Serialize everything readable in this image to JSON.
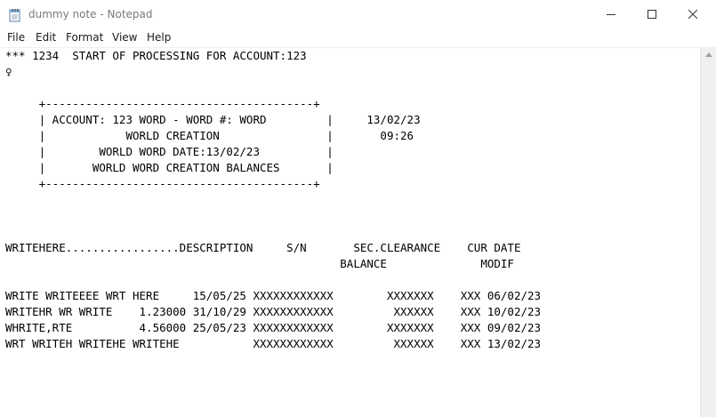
{
  "window": {
    "title": "dummy note - Notepad",
    "minimize_glyph": "—",
    "maximize_glyph": "☐",
    "close_glyph": "✕"
  },
  "menu": [
    "File",
    "Edit",
    "Format",
    "View",
    "Help"
  ],
  "editor": {
    "lines": [
      "*** 1234  START OF PROCESSING FOR ACCOUNT:123",
      "♀",
      "",
      "     +----------------------------------------+",
      "     | ACCOUNT: 123 WORD - WORD #: WORD         |     13/02/23",
      "     |            WORLD CREATION                |       09:26",
      "     |        WORLD WORD DATE:13/02/23          |",
      "     |       WORLD WORD CREATION BALANCES       |",
      "     +----------------------------------------+",
      "",
      "",
      "",
      "WRITEHERE.................DESCRIPTION     S/N       SEC.CLEARANCE    CUR DATE",
      "                                                  BALANCE              MODIF",
      "",
      "WRITE WRITEEEE WRT HERE     15/05/25 XXXXXXXXXXXX        XXXXXXX    XXX 06/02/23",
      "WRITEHR WR WRITE    1.23000 31/10/29 XXXXXXXXXXXX         XXXXXX    XXX 10/02/23",
      "WHRITE,RTE          4.56000 25/05/23 XXXXXXXXXXXX        XXXXXXX    XXX 09/02/23",
      "WRT WRITEH WRITEHE WRITEHE           XXXXXXXXXXXX         XXXXXX    XXX 13/02/23"
    ]
  }
}
